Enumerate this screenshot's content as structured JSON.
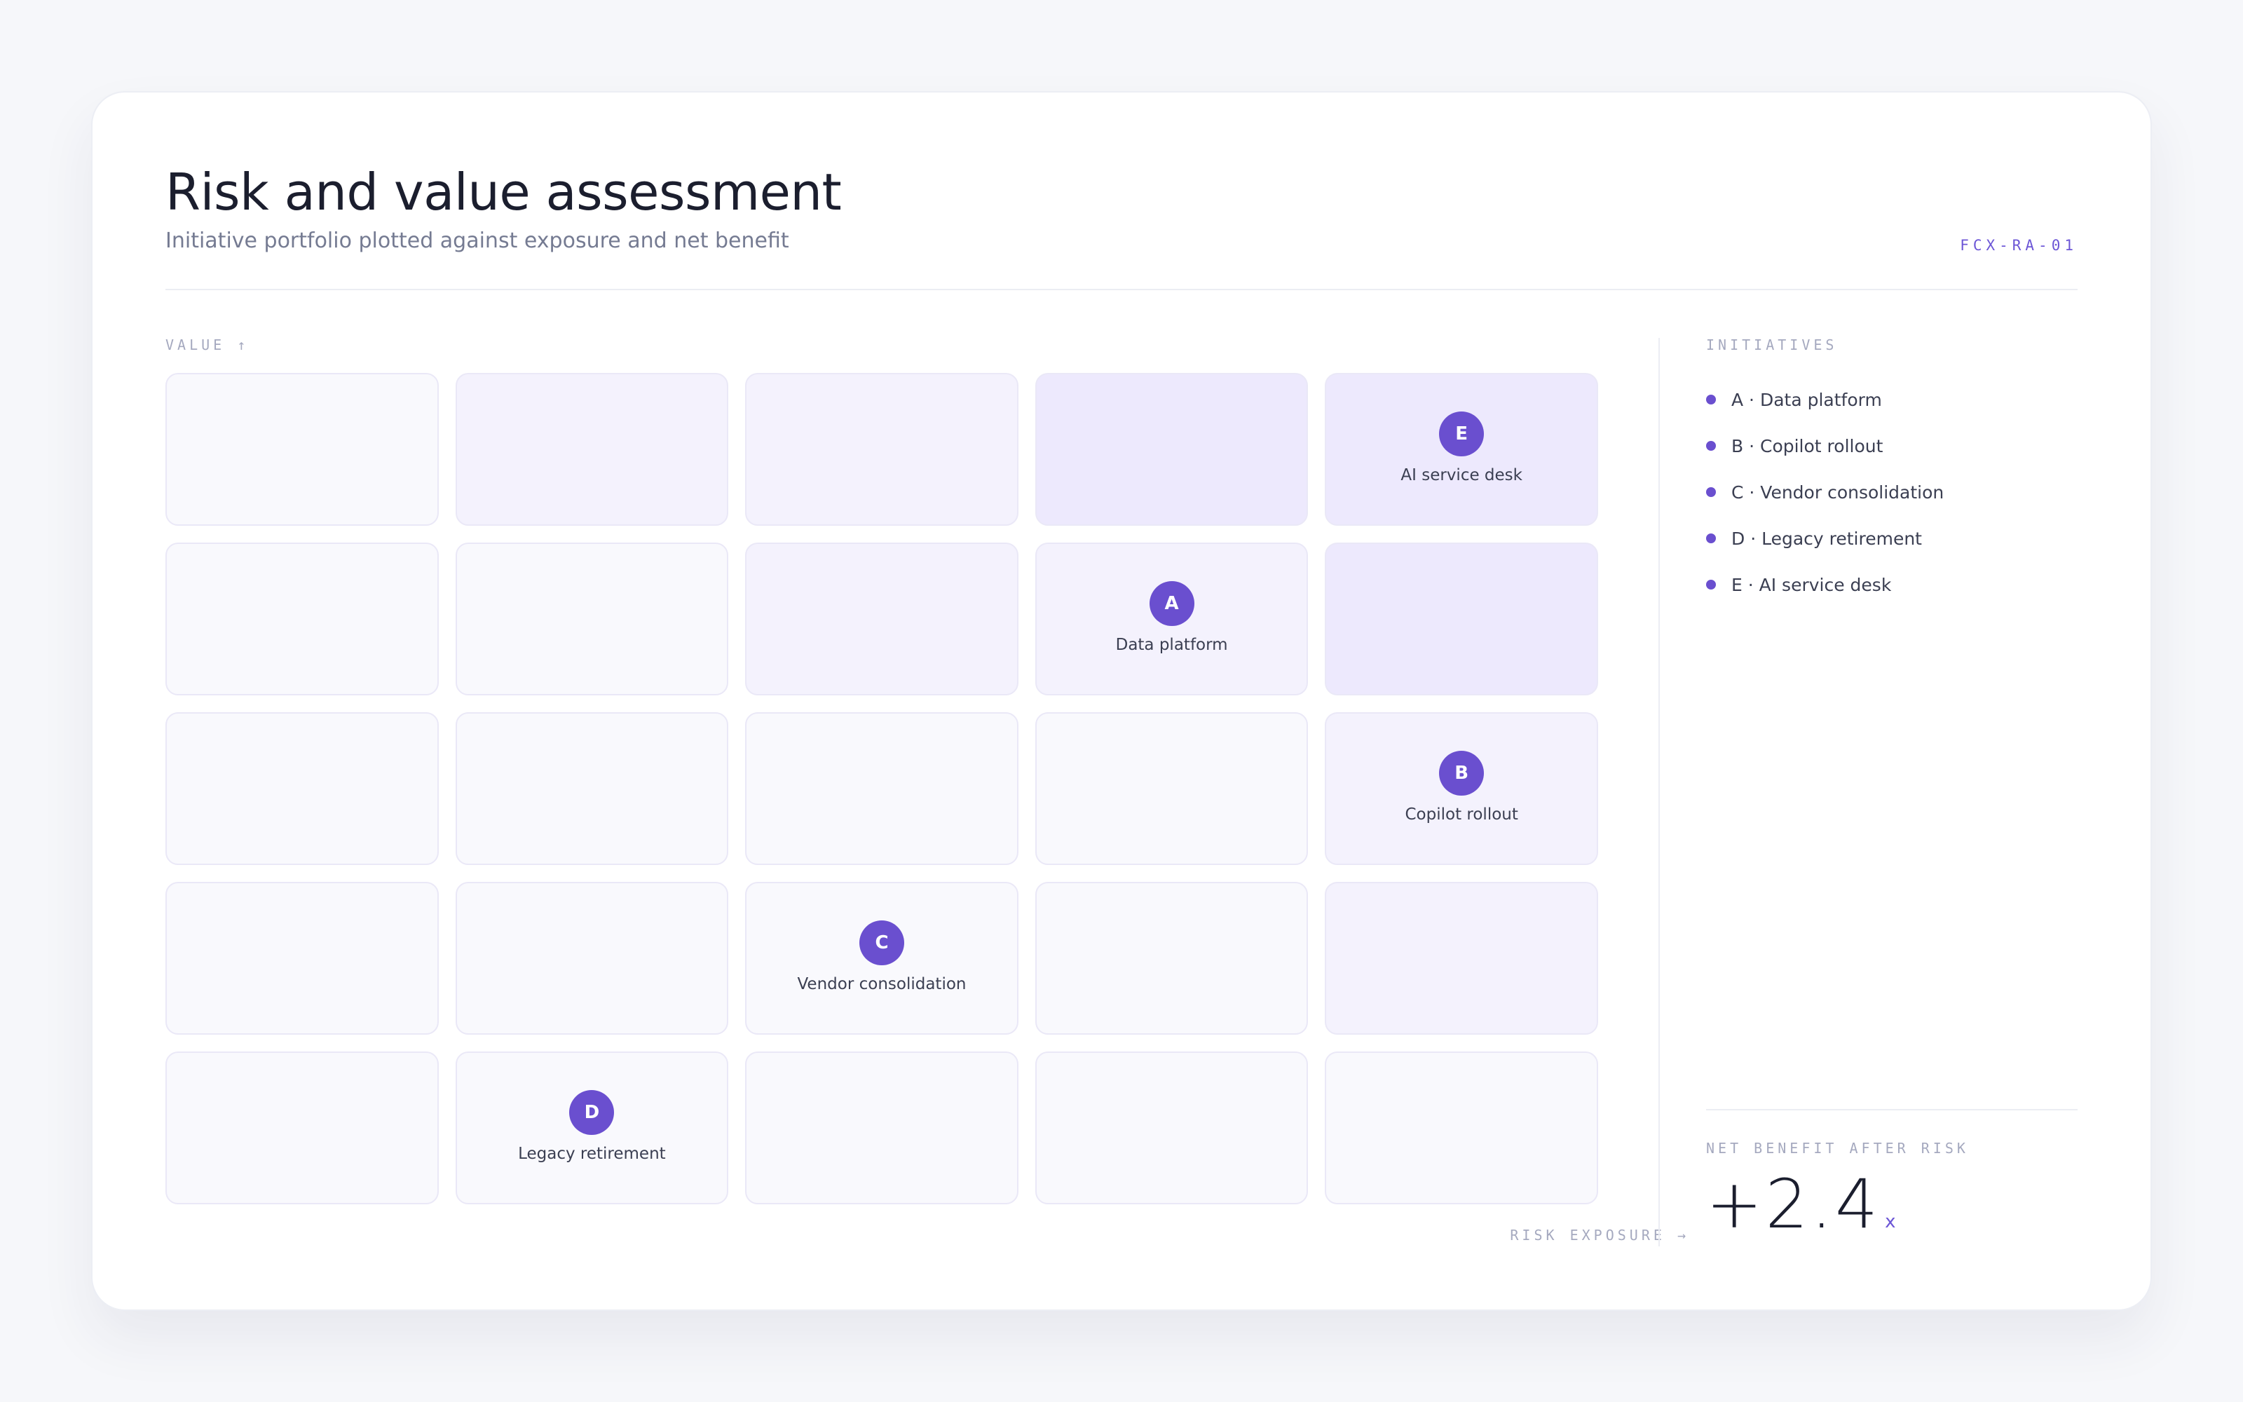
{
  "header": {
    "title": "Risk and value assessment",
    "subtitle": "Initiative portfolio plotted against exposure and net benefit",
    "code": "FCX-RA-01"
  },
  "matrix": {
    "y_axis_label": "VALUE ↑",
    "x_axis_label": "RISK EXPOSURE →",
    "rows": 5,
    "columns": 5,
    "cell_tints": [
      [
        0,
        1,
        1,
        2,
        2
      ],
      [
        0,
        0,
        1,
        1,
        2
      ],
      [
        0,
        0,
        0,
        0,
        1
      ],
      [
        0,
        0,
        0,
        0,
        1
      ],
      [
        0,
        0,
        0,
        0,
        0
      ]
    ],
    "initiatives": [
      {
        "letter": "A",
        "name": "Data platform",
        "risk": 4,
        "value": 4
      },
      {
        "letter": "B",
        "name": "Copilot rollout",
        "risk": 5,
        "value": 3
      },
      {
        "letter": "C",
        "name": "Vendor consolidation",
        "risk": 3,
        "value": 2
      },
      {
        "letter": "D",
        "name": "Legacy retirement",
        "risk": 2,
        "value": 1
      },
      {
        "letter": "E",
        "name": "AI service desk",
        "risk": 5,
        "value": 5
      }
    ]
  },
  "legend": {
    "title": "INITIATIVES",
    "items": [
      "A · Data platform",
      "B · Copilot rollout",
      "C · Vendor consolidation",
      "D · Legacy retirement",
      "E · AI service desk"
    ]
  },
  "kpi": {
    "label": "NET BENEFIT AFTER RISK",
    "value": "+2.4",
    "unit": "x"
  },
  "colors": {
    "accent": "#6a4fcf",
    "tint_0": "#f9f9fd",
    "tint_1": "#f4f2fd",
    "tint_2": "#ede9fd"
  }
}
